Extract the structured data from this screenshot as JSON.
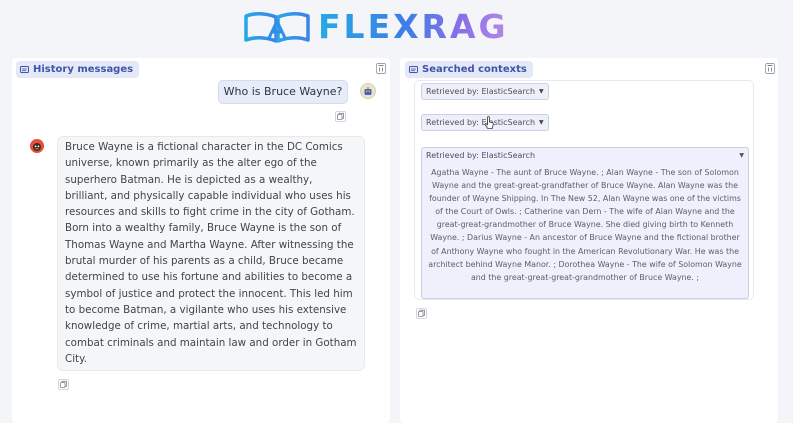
{
  "app": {
    "logo_text": "FLEXRAG"
  },
  "history_panel": {
    "label": "History messages",
    "user_message": "Who is Bruce Wayne?",
    "assistant_message": "Bruce Wayne is a fictional character in the DC Comics universe, known primarily as the alter ego of the superhero Batman. He is depicted as a wealthy, brilliant, and physically capable individual who uses his resources and skills to fight crime in the city of Gotham. Born into a wealthy family, Bruce Wayne is the son of Thomas Wayne and Martha Wayne. After witnessing the brutal murder of his parents as a child, Bruce became determined to use his fortune and abilities to become a symbol of justice and protect the innocent. This led him to become Batman, a vigilante who uses his extensive knowledge of crime, martial arts, and technology to combat criminals and maintain law and order in Gotham City."
  },
  "contexts_panel": {
    "label": "Searched contexts",
    "retrievers": [
      {
        "label": "Retrieved by: ElasticSearch"
      },
      {
        "label": "Retrieved by: ElasticSearch"
      },
      {
        "label": "Retrieved by: ElasticSearch",
        "content": "Agatha Wayne - The aunt of Bruce Wayne. ; Alan Wayne - The son of Solomon Wayne and the great-great-grandfather of Bruce Wayne. Alan Wayne was the founder of Wayne Shipping. In The New 52, Alan Wayne was one of the victims of the Court of Owls. ; Catherine van Dern - The wife of Alan Wayne and the great-great-grandmother of Bruce Wayne. She died giving birth to Kenneth Wayne. ; Darius Wayne - An ancestor of Bruce Wayne and the fictional brother of Anthony Wayne who fought in the American Revolutionary War. He was the architect behind Wayne Manor. ; Dorothea Wayne - The wife of Solomon Wayne and the great-great-great-grandmother of Bruce Wayne. ;"
      }
    ]
  },
  "colors": {
    "accent": "#3f55a8",
    "label_bg": "#e4e8f7",
    "bubble_bg": "#e6ecf8"
  }
}
